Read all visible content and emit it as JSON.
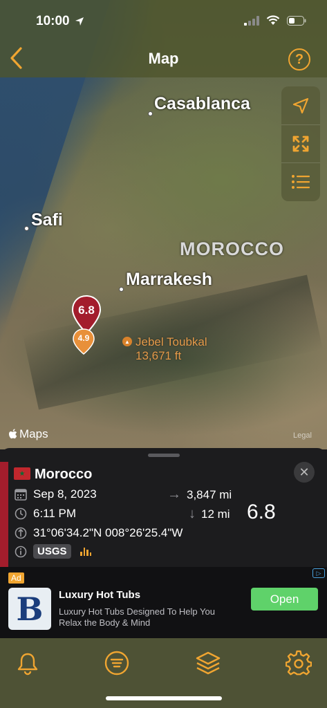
{
  "status_bar": {
    "time": "10:00"
  },
  "header": {
    "title": "Map",
    "back_icon": "chevron-left-icon",
    "help_label": "?"
  },
  "map": {
    "cities": [
      {
        "name": "Casablanca"
      },
      {
        "name": "Safi"
      },
      {
        "name": "Marrakesh"
      }
    ],
    "country_label": "MOROCCO",
    "peak": {
      "name": "Jebel Toubkal",
      "elevation": "13,671 ft"
    },
    "attribution": "Maps",
    "legal": "Legal",
    "controls": [
      "location-arrow-icon",
      "expand-icon",
      "list-icon"
    ],
    "pins": [
      {
        "magnitude": "6.8",
        "color": "#a31d2c"
      },
      {
        "magnitude": "4.9",
        "color": "#e8903a"
      }
    ]
  },
  "quake": {
    "country": "Morocco",
    "date": "Sep 8, 2023",
    "time": "6:11 PM",
    "coordinates": "31°06'34.2\"N 008°26'25.4\"W",
    "distance": "3,847 mi",
    "depth": "12 mi",
    "magnitude": "6.8",
    "source": "USGS",
    "accent_color": "#a31d2c"
  },
  "ad": {
    "badge": "Ad",
    "title": "Luxury Hot Tubs",
    "description": "Luxury Hot Tubs Designed To Help You Relax the Body & Mind",
    "cta": "Open"
  },
  "tabs": [
    "bell-icon",
    "list-circle-icon",
    "layers-icon",
    "gear-icon"
  ],
  "colors": {
    "accent": "#f0a531"
  }
}
